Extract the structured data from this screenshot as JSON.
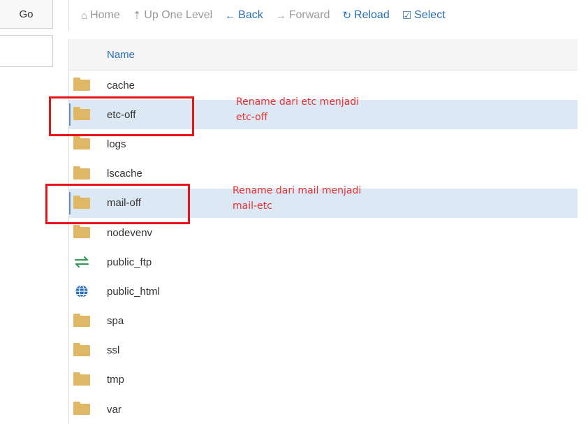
{
  "left_panel": {
    "go_label": "Go"
  },
  "toolbar": {
    "items": [
      {
        "label": "Home",
        "icon": "home-icon",
        "glyph": "⌂",
        "active": false
      },
      {
        "label": "Up One Level",
        "icon": "level-up-icon",
        "glyph": "⇡",
        "active": false
      },
      {
        "label": "Back",
        "icon": "arrow-left-icon",
        "glyph": "←",
        "active": true
      },
      {
        "label": "Forward",
        "icon": "arrow-right-icon",
        "glyph": "→",
        "active": false
      },
      {
        "label": "Reload",
        "icon": "reload-icon",
        "glyph": "↻",
        "active": true
      },
      {
        "label": "Select",
        "icon": "checkbox-icon",
        "glyph": "☑",
        "active": true
      }
    ]
  },
  "file_list": {
    "header_name": "Name",
    "rows": [
      {
        "name": "cache",
        "icon": "folder-icon",
        "selected": false
      },
      {
        "name": "etc-off",
        "icon": "folder-icon",
        "selected": true
      },
      {
        "name": "logs",
        "icon": "folder-icon",
        "selected": false
      },
      {
        "name": "lscache",
        "icon": "folder-icon",
        "selected": false
      },
      {
        "name": "mail-off",
        "icon": "folder-icon",
        "selected": true
      },
      {
        "name": "nodevenv",
        "icon": "folder-icon",
        "selected": false
      },
      {
        "name": "public_ftp",
        "icon": "transfer-icon",
        "selected": false
      },
      {
        "name": "public_html",
        "icon": "globe-icon",
        "selected": false
      },
      {
        "name": "spa",
        "icon": "folder-icon",
        "selected": false
      },
      {
        "name": "ssl",
        "icon": "folder-icon",
        "selected": false
      },
      {
        "name": "tmp",
        "icon": "folder-icon",
        "selected": false
      },
      {
        "name": "var",
        "icon": "folder-icon",
        "selected": false
      }
    ]
  },
  "annotations": [
    {
      "line1": "Rename dari etc menjadi",
      "line2": "etc-off"
    },
    {
      "line1": "Rename dari mail menjadi",
      "line2": "mail-etc"
    }
  ],
  "colors": {
    "accent": "#2a6ebb",
    "selected_row": "#dce9f5",
    "folder": "#e0b765",
    "annotation": "#e8141a"
  }
}
